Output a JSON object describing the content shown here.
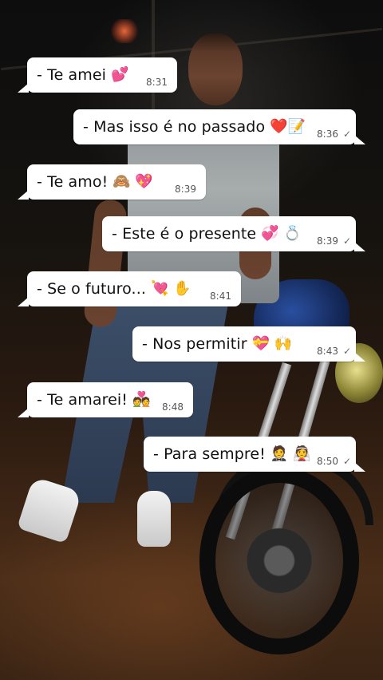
{
  "messages": [
    {
      "text": "- Te amei",
      "emoji": "💕",
      "time": "8:31",
      "direction": "in"
    },
    {
      "text": "- Mas isso é no passado",
      "emoji": "❤️📝",
      "time": "8:36",
      "direction": "out"
    },
    {
      "text": "-  Te amo!",
      "emoji": "🙈 💖",
      "time": "8:39",
      "direction": "in"
    },
    {
      "text": "- Este é o presente",
      "emoji": "💞 💍",
      "time": "8:39",
      "direction": "out"
    },
    {
      "text": "-  Se o futuro...",
      "emoji": "💘 ✋",
      "time": "8:41",
      "direction": "in"
    },
    {
      "text": "-  Nos permitir",
      "emoji": "💝 🙌",
      "time": "8:43",
      "direction": "out"
    },
    {
      "text": "- Te amarei!",
      "emoji": "💑",
      "time": "8:48",
      "direction": "in"
    },
    {
      "text": "- Para sempre!",
      "emoji": "🤵 👰",
      "time": "8:50",
      "direction": "out"
    }
  ],
  "read_receipt_icon": "single-check-icon",
  "colors": {
    "bubble": "#ffffff",
    "text": "#111111",
    "time": "#555555"
  }
}
